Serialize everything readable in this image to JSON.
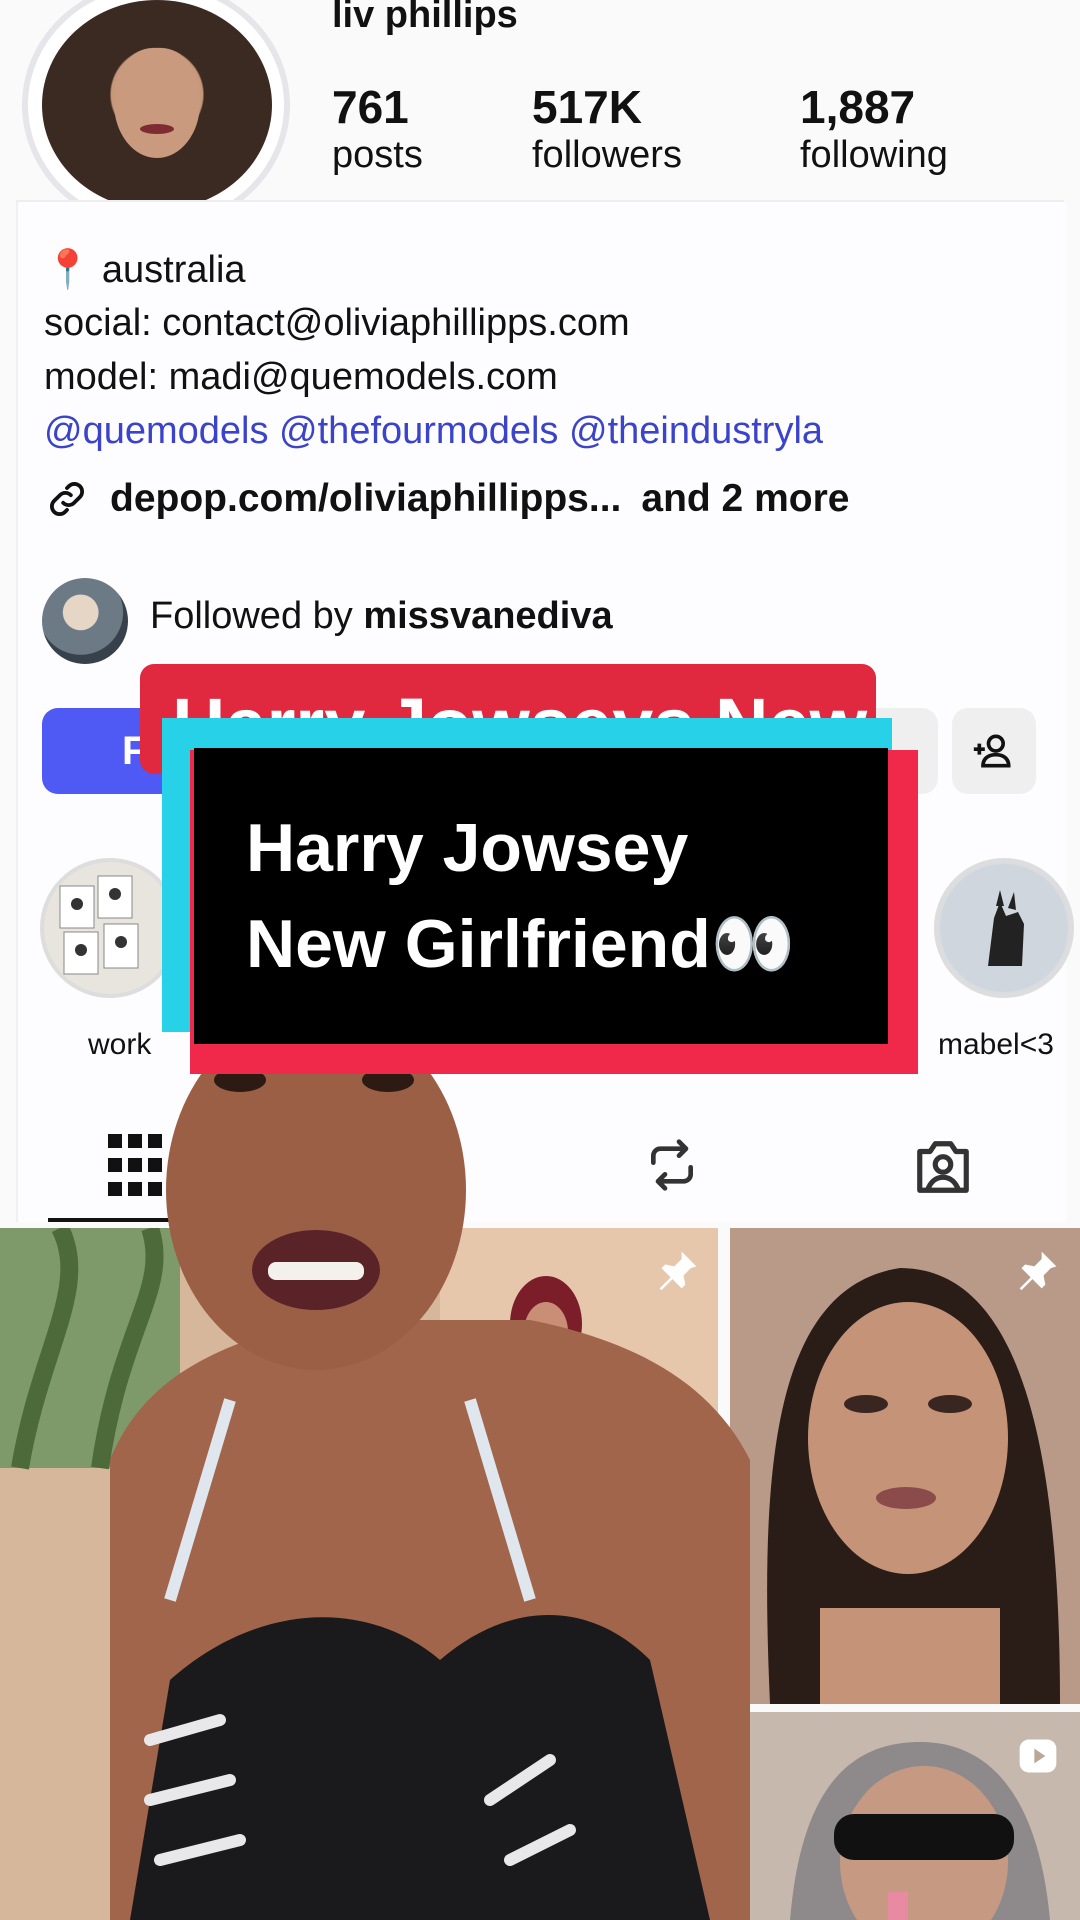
{
  "profile": {
    "username": "liv phillips",
    "stats": [
      {
        "value": "761",
        "label": "posts"
      },
      {
        "value": "517K",
        "label": "followers"
      },
      {
        "value": "1,887",
        "label": "following"
      }
    ]
  },
  "bio": {
    "location_icon": "📍",
    "location": "australia",
    "social": "social: contact@oliviaphillipps.com",
    "model": "model: madi@quemodels.com",
    "mentions": [
      "@quemodels",
      "@thefourmodels",
      "@theindustryla"
    ],
    "link": "depop.com/oliviaphillipps...",
    "link_more": "and 2 more"
  },
  "followed_by": {
    "prefix": "Followed by",
    "user": "missvanediva"
  },
  "buttons": {
    "follow_label": "F"
  },
  "highlights": [
    {
      "label": "work"
    },
    {
      "label": "mabel<3"
    }
  ],
  "overlay": {
    "back_title": "Harry Jowseys New",
    "title_line1": "Harry Jowsey",
    "title_line2": "New Girlfriend👀"
  },
  "colors": {
    "follow_blue": "#4f59f4",
    "mention_blue": "#3a43c9",
    "banner_red": "#e0283e",
    "frame_cyan": "#27d2e8",
    "frame_red": "#f0294a"
  }
}
